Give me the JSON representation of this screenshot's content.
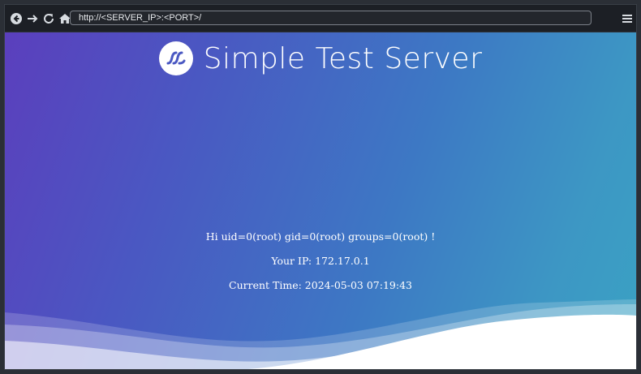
{
  "browser": {
    "url": "http://<SERVER_IP>:<PORT>/",
    "buttons": [
      "back-icon",
      "forward-icon",
      "reload-icon",
      "home-icon",
      "menu-icon"
    ]
  },
  "page": {
    "title": "Simple Test Server",
    "logo_icon": "wave-logo-icon",
    "greeting": "Hi uid=0(root) gid=0(root) groups=0(root) !",
    "ip_line": "Your IP: 172.17.0.1",
    "time_line": "Current Time: 2024-05-03 07:19:43"
  },
  "colors": {
    "gradient_start": "#5b3fbd",
    "gradient_end": "#3aa2c3",
    "toolbar": "#1c1f25"
  }
}
